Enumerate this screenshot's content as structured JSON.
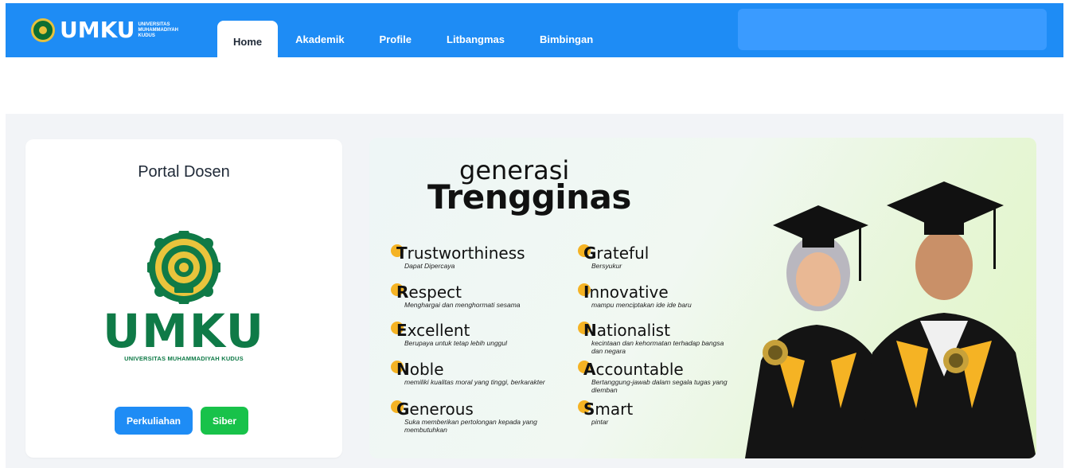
{
  "header": {
    "logo_word": "UMKU",
    "logo_sub": [
      "UNIVERSITAS",
      "MUHAMMADIYAH",
      "KUDUS"
    ],
    "tabs": [
      {
        "label": "Home",
        "active": true
      },
      {
        "label": "Akademik",
        "active": false
      },
      {
        "label": "Profile",
        "active": false
      },
      {
        "label": "Litbangmas",
        "active": false
      },
      {
        "label": "Bimbingan",
        "active": false
      }
    ]
  },
  "portal": {
    "title": "Portal Dosen",
    "logo_word": "UMKU",
    "logo_caption": "UNIVERSITAS MUHAMMADIYAH KUDUS",
    "buttons": {
      "perkuliahan": "Perkuliahan",
      "siber": "Siber"
    }
  },
  "banner": {
    "small_title": "generasi",
    "big_title": "Trengginas",
    "values_left": [
      {
        "initial": "T",
        "rest": "rustworthiness",
        "desc": "Dapat Dipercaya"
      },
      {
        "initial": "R",
        "rest": "espect",
        "desc": "Menghargai dan menghormati sesama"
      },
      {
        "initial": "E",
        "rest": "xcellent",
        "desc": "Berupaya untuk tetap lebih unggul"
      },
      {
        "initial": "N",
        "rest": "oble",
        "desc": "memiliki kualitas moral yang tinggi, berkarakter"
      },
      {
        "initial": "G",
        "rest": "enerous",
        "desc": "Suka memberikan pertolongan kepada yang membutuhkan"
      }
    ],
    "values_right": [
      {
        "initial": "G",
        "rest": "rateful",
        "desc": "Bersyukur"
      },
      {
        "initial": "I",
        "rest": "nnovative",
        "desc": "mampu menciptakan ide ide baru"
      },
      {
        "initial": "N",
        "rest": "ationalist",
        "desc": "kecintaan dan kehormatan terhadap bangsa dan negara"
      },
      {
        "initial": "A",
        "rest": "ccountable",
        "desc": "Bertanggung-jawab dalam segala tugas yang diemban"
      },
      {
        "initial": "S",
        "rest": "mart",
        "desc": "pintar"
      }
    ]
  },
  "colors": {
    "nav": "#1e8cf5",
    "green": "#18c24a",
    "umku_green": "#0f7a47",
    "gold": "#f5b324"
  }
}
